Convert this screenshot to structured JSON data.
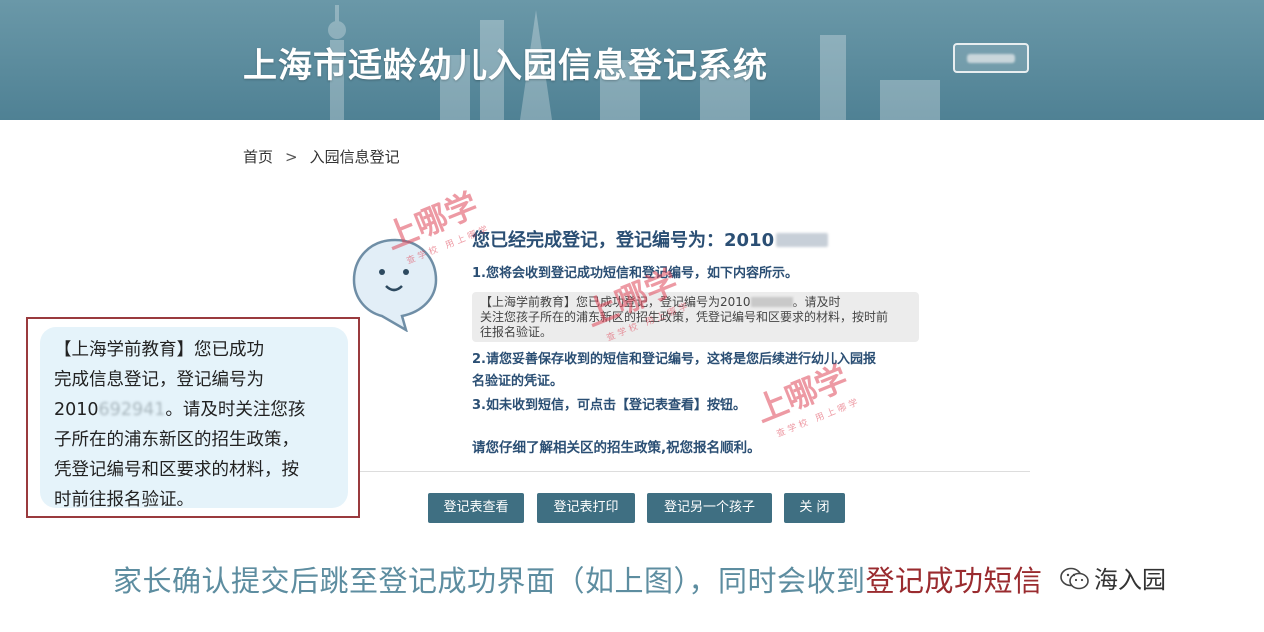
{
  "header": {
    "title": "上海市适龄幼儿入园信息登记系统"
  },
  "breadcrumb": {
    "home": "首页",
    "separator": ">",
    "current": "入园信息登记"
  },
  "panel": {
    "title_prefix": "您已经完成登记，登记编号为：2010",
    "step1": "1.您将会收到登记成功短信和登记编号，如下内容所示。",
    "sms_line1_a": "【上海学前教育】您已成功登记，登记编号为2010",
    "sms_line1_b": "。请及时",
    "sms_line2": "关注您孩子所在的浦东新区的招生政策，凭登记编号和区要求的材料，按时前",
    "sms_line3": "往报名验证。",
    "step2_line1": "2.请您妥善保存收到的短信和登记编号，这将是您后续进行幼儿入园报",
    "step2_line2": "名验证的凭证。",
    "step3": "3.如未收到短信，可点击【登记表查看】按钮。",
    "closing": "请您仔细了解相关区的招生政策,祝您报名顺利。"
  },
  "buttons": {
    "view": "登记表查看",
    "print": "登记表打印",
    "another": "登记另一个孩子",
    "close": "关 闭"
  },
  "sms_card": {
    "line1": "【上海学前教育】您已成功",
    "line2": "完成信息登记，登记编号为",
    "line3_prefix": "2010",
    "line3_blurred": "692941",
    "line3_suffix": "。请及时关注您孩",
    "line4": "子所在的浦东新区的招生政策，",
    "line5": "凭登记编号和区要求的材料，按",
    "line6": "时前往报名验证。"
  },
  "caption": {
    "text": "家长确认提交后跳至登记成功界面（如上图），同时会收到",
    "highlight": "登记成功短信"
  },
  "wechat_mark": {
    "text": "海入园"
  },
  "watermark": {
    "brand": "上哪学",
    "sub": "查学校 用上哪学"
  },
  "colors": {
    "banner": "#5a8c9e",
    "button": "#3f6f82",
    "panel_text": "#2b4f74",
    "card_border": "#9a3a3e",
    "caption": "#5d8da0",
    "highlight": "#9a2b2f",
    "watermark": "#e0485a"
  }
}
